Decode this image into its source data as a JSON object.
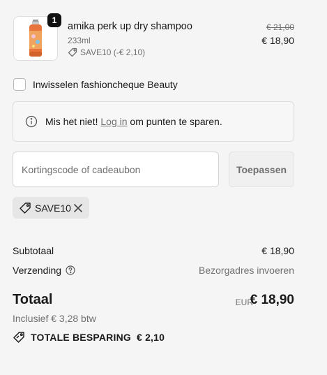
{
  "cart_item": {
    "quantity": "1",
    "name": "amika perk up dry shampoo",
    "variant": "233ml",
    "discount_note": "SAVE10 (-€ 2,10)",
    "price_original": "€ 21,00",
    "price_current": "€ 18,90"
  },
  "gift_option": {
    "label": "Inwisselen fashioncheque Beauty",
    "checked": false
  },
  "login_banner": {
    "text_before": "Mis het niet! ",
    "link_text": "Log in",
    "text_after": " om punten te sparen."
  },
  "discount_form": {
    "placeholder": "Kortingscode of cadeaubon",
    "apply_label": "Toepassen"
  },
  "applied_code": {
    "code": "SAVE10"
  },
  "summary": {
    "subtotal_label": "Subtotaal",
    "subtotal_value": "€ 18,90",
    "shipping_label": "Verzending",
    "shipping_value": "Bezorgadres invoeren",
    "total_label": "Totaal",
    "total_currency": "EUR",
    "total_value": "€ 18,90",
    "tax_note": "Inclusief € 3,28 btw",
    "savings_label": "TOTALE BESPARING",
    "savings_value": "€ 2,10"
  },
  "colors": {
    "background": "#f5f5f5",
    "text": "#1a1a1a",
    "muted": "#707070",
    "badge": "#111111",
    "product_can": "#e8743b"
  }
}
